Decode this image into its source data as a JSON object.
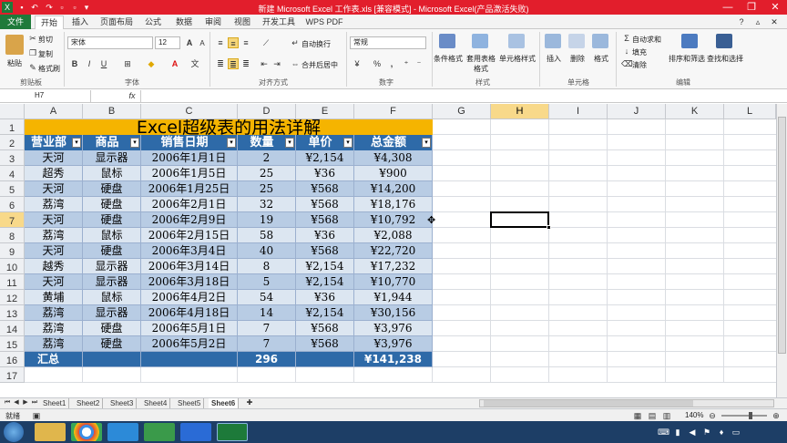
{
  "window": {
    "title": "新建 Microsoft Excel 工作表.xls  [兼容模式] - Microsoft Excel(产品激活失败)",
    "min": "—",
    "restore": "❐",
    "close": "✕"
  },
  "menu": {
    "tabs": [
      "文件",
      "开始",
      "插入",
      "页面布局",
      "公式",
      "数据",
      "审阅",
      "视图",
      "开发工具",
      "WPS PDF"
    ],
    "active": "开始"
  },
  "ribbon": {
    "clipboard": {
      "paste": "粘贴",
      "cut": "剪切",
      "copy": "复制",
      "format_painter": "格式刷",
      "label": "剪贴板"
    },
    "font": {
      "name": "宋体",
      "size": "12",
      "bold": "B",
      "italic": "I",
      "underline": "U",
      "label": "字体",
      "grow": "A",
      "shrink": "A",
      "fontcolor": "A"
    },
    "align": {
      "wrap": "自动换行",
      "merge": "合并后居中",
      "label": "对齐方式"
    },
    "number": {
      "format": "常规",
      "percent": "%",
      "comma": ",",
      "label": "数字"
    },
    "styles": {
      "cond": "条件格式",
      "table": "套用表格格式",
      "cell": "单元格样式",
      "label": "样式"
    },
    "cells": {
      "insert": "插入",
      "delete": "删除",
      "format": "格式",
      "label": "单元格"
    },
    "editing": {
      "autosum": "自动求和",
      "fill": "填充",
      "clear": "清除",
      "sort": "排序和筛选",
      "find": "查找和选择",
      "label": "编辑"
    }
  },
  "formula_bar": {
    "name_box": "H7",
    "fx": "fx",
    "value": ""
  },
  "columns": [
    "A",
    "B",
    "C",
    "D",
    "E",
    "F",
    "G",
    "H",
    "I",
    "J",
    "K",
    "L"
  ],
  "selected_col": "H",
  "selected_row": "7",
  "sheet": {
    "title": "Excel超级表的用法详解",
    "headers": [
      "营业部",
      "商品",
      "销售日期",
      "数量",
      "单价",
      "总金额"
    ],
    "rows": [
      [
        "天河",
        "显示器",
        "2006年1月1日",
        "2",
        "¥2,154",
        "¥4,308"
      ],
      [
        "超秀",
        "鼠标",
        "2006年1月5日",
        "25",
        "¥36",
        "¥900"
      ],
      [
        "天河",
        "硬盘",
        "2006年1月25日",
        "25",
        "¥568",
        "¥14,200"
      ],
      [
        "荔湾",
        "硬盘",
        "2006年2月1日",
        "32",
        "¥568",
        "¥18,176"
      ],
      [
        "天河",
        "硬盘",
        "2006年2月9日",
        "19",
        "¥568",
        "¥10,792"
      ],
      [
        "荔湾",
        "鼠标",
        "2006年2月15日",
        "58",
        "¥36",
        "¥2,088"
      ],
      [
        "天河",
        "硬盘",
        "2006年3月4日",
        "40",
        "¥568",
        "¥22,720"
      ],
      [
        "越秀",
        "显示器",
        "2006年3月14日",
        "8",
        "¥2,154",
        "¥17,232"
      ],
      [
        "天河",
        "显示器",
        "2006年3月18日",
        "5",
        "¥2,154",
        "¥10,770"
      ],
      [
        "黄埔",
        "鼠标",
        "2006年4月2日",
        "54",
        "¥36",
        "¥1,944"
      ],
      [
        "荔湾",
        "显示器",
        "2006年4月18日",
        "14",
        "¥2,154",
        "¥30,156"
      ],
      [
        "荔湾",
        "硬盘",
        "2006年5月1日",
        "7",
        "¥568",
        "¥3,976"
      ],
      [
        "荔湾",
        "硬盘",
        "2006年5月2日",
        "7",
        "¥568",
        "¥3,976"
      ]
    ],
    "total": {
      "label": "汇总",
      "qty": "296",
      "amount": "¥141,238"
    },
    "row_numbers": [
      "1",
      "2",
      "3",
      "4",
      "5",
      "6",
      "7",
      "8",
      "9",
      "10",
      "11",
      "12",
      "13",
      "14",
      "15",
      "16",
      "17"
    ]
  },
  "sheet_tabs": [
    "Sheet1",
    "Sheet2",
    "Sheet3",
    "Sheet4",
    "Sheet5",
    "Sheet6"
  ],
  "active_sheet": "Sheet6",
  "status": {
    "ready": "就绪",
    "zoom": "140%"
  },
  "colors": {
    "header_blue": "#2e6aa8",
    "title_gold": "#f5b400",
    "band_light": "#dce6f1",
    "band_dark": "#b8cce4",
    "excel_green": "#1f7a3a",
    "title_red": "#e21e2c"
  }
}
